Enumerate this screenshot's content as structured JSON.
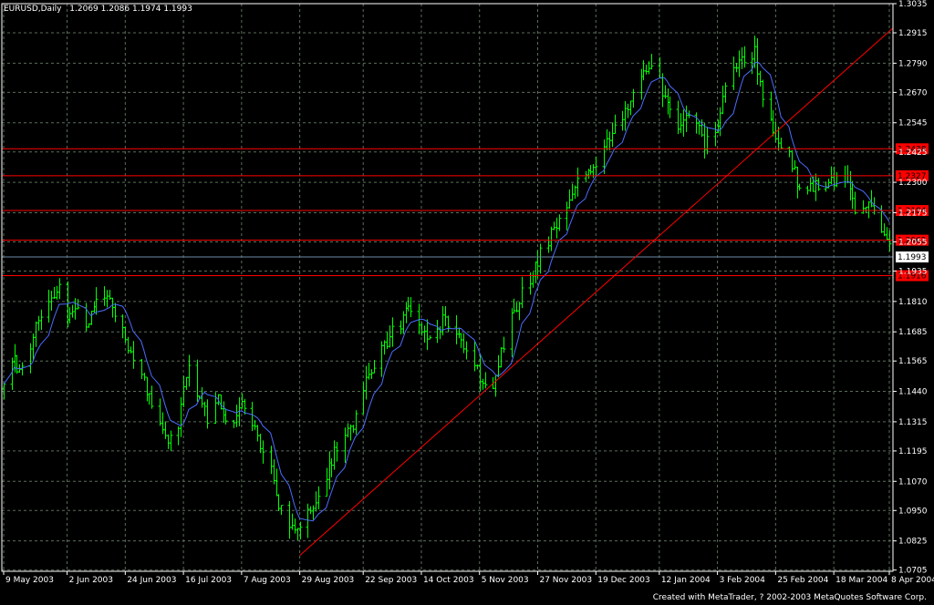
{
  "header": {
    "symbol": "EURUSD,Daily",
    "ohlc": "1.2069 1.2086 1.1974 1.1993"
  },
  "footer": {
    "credit": "Created with MetaTrader, ? 2002-2003 MetaQuotes Software Corp."
  },
  "colors": {
    "background": "#000000",
    "frame": "#ffffff",
    "grid": "#5a6e5a",
    "bars": "#00ff00",
    "moving_average": "#4c6cff",
    "levels": "#ff0000",
    "price_line": "#6e8aa8"
  },
  "chart_data": {
    "type": "ohlc_bar",
    "ylim": [
      1.07,
      1.3035
    ],
    "grid": true,
    "y_ticks": [
      "1.3035",
      "1.2915",
      "1.2790",
      "1.2670",
      "1.2545",
      "1.2425",
      "1.2300",
      "1.2175",
      "1.2055",
      "1.1935",
      "1.1810",
      "1.1685",
      "1.1565",
      "1.1440",
      "1.1315",
      "1.1195",
      "1.1070",
      "1.0950",
      "1.0825",
      "1.0705"
    ],
    "x_ticks": [
      "9 May 2003",
      "2 Jun 2003",
      "24 Jun 2003",
      "16 Jul 2003",
      "7 Aug 2003",
      "29 Aug 2003",
      "22 Sep 2003",
      "14 Oct 2003",
      "5 Nov 2003",
      "27 Nov 2003",
      "19 Dec 2003",
      "12 Jan 2004",
      "3 Feb 2004",
      "25 Feb 2004",
      "18 Mar 2004",
      "8 Apr 2004"
    ],
    "current_price": "1.1993",
    "horizontal_levels": [
      "1.2438",
      "1.2327",
      "1.2184",
      "1.2062",
      "1.1916"
    ],
    "trendline": {
      "from": [
        "29 Aug 2003",
        1.0765
      ],
      "to": [
        "8 Apr 2004",
        1.2845
      ]
    },
    "close_path": [
      [
        "9 May 2003",
        1.145
      ],
      [
        "13 May 2003",
        1.156
      ],
      [
        "16 May 2003",
        1.152
      ],
      [
        "21 May 2003",
        1.17
      ],
      [
        "26 May 2003",
        1.181
      ],
      [
        "30 May 2003",
        1.188
      ],
      [
        "2 Jun 2003",
        1.176
      ],
      [
        "5 Jun 2003",
        1.18
      ],
      [
        "9 Jun 2003",
        1.17
      ],
      [
        "12 Jun 2003",
        1.179
      ],
      [
        "16 Jun 2003",
        1.185
      ],
      [
        "20 Jun 2003",
        1.175
      ],
      [
        "24 Jun 2003",
        1.165
      ],
      [
        "27 Jun 2003",
        1.156
      ],
      [
        "1 Jul 2003",
        1.147
      ],
      [
        "4 Jul 2003",
        1.137
      ],
      [
        "8 Jul 2003",
        1.13
      ],
      [
        "11 Jul 2003",
        1.123
      ],
      [
        "14 Jul 2003",
        1.13
      ],
      [
        "16 Jul 2003",
        1.145
      ],
      [
        "18 Jul 2003",
        1.152
      ],
      [
        "22 Jul 2003",
        1.142
      ],
      [
        "25 Jul 2003",
        1.133
      ],
      [
        "29 Jul 2003",
        1.14
      ],
      [
        "1 Aug 2003",
        1.13
      ],
      [
        "5 Aug 2003",
        1.134
      ],
      [
        "7 Aug 2003",
        1.138
      ],
      [
        "11 Aug 2003",
        1.129
      ],
      [
        "14 Aug 2003",
        1.123
      ],
      [
        "18 Aug 2003",
        1.113
      ],
      [
        "21 Aug 2003",
        1.098
      ],
      [
        "25 Aug 2003",
        1.088
      ],
      [
        "27 Aug 2003",
        1.085
      ],
      [
        "29 Aug 2003",
        1.09
      ],
      [
        "3 Sep 2003",
        1.096
      ],
      [
        "8 Sep 2003",
        1.108
      ],
      [
        "11 Sep 2003",
        1.12
      ],
      [
        "15 Sep 2003",
        1.124
      ],
      [
        "18 Sep 2003",
        1.13
      ],
      [
        "22 Sep 2003",
        1.145
      ],
      [
        "26 Sep 2003",
        1.155
      ],
      [
        "1 Oct 2003",
        1.165
      ],
      [
        "6 Oct 2003",
        1.172
      ],
      [
        "9 Oct 2003",
        1.178
      ],
      [
        "14 Oct 2003",
        1.17
      ],
      [
        "17 Oct 2003",
        1.165
      ],
      [
        "22 Oct 2003",
        1.173
      ],
      [
        "27 Oct 2003",
        1.17
      ],
      [
        "31 Oct 2003",
        1.16
      ],
      [
        "5 Nov 2003",
        1.15
      ],
      [
        "10 Nov 2003",
        1.147
      ],
      [
        "14 Nov 2003",
        1.164
      ],
      [
        "19 Nov 2003",
        1.18
      ],
      [
        "24 Nov 2003",
        1.19
      ],
      [
        "27 Nov 2003",
        1.198
      ],
      [
        "2 Dec 2003",
        1.208
      ],
      [
        "8 Dec 2003",
        1.22
      ],
      [
        "12 Dec 2003",
        1.229
      ],
      [
        "16 Dec 2003",
        1.236
      ],
      [
        "19 Dec 2003",
        1.239
      ],
      [
        "24 Dec 2003",
        1.248
      ],
      [
        "31 Dec 2003",
        1.26
      ],
      [
        "6 Jan 2004",
        1.278
      ],
      [
        "9 Jan 2004",
        1.276
      ],
      [
        "12 Jan 2004",
        1.27
      ],
      [
        "15 Jan 2004",
        1.26
      ],
      [
        "19 Jan 2004",
        1.25
      ],
      [
        "22 Jan 2004",
        1.256
      ],
      [
        "26 Jan 2004",
        1.253
      ],
      [
        "29 Jan 2004",
        1.246
      ],
      [
        "3 Feb 2004",
        1.252
      ],
      [
        "6 Feb 2004",
        1.27
      ],
      [
        "11 Feb 2004",
        1.281
      ],
      [
        "17 Feb 2004",
        1.283
      ],
      [
        "20 Feb 2004",
        1.265
      ],
      [
        "25 Feb 2004",
        1.25
      ],
      [
        "1 Mar 2004",
        1.242
      ],
      [
        "4 Mar 2004",
        1.23
      ],
      [
        "9 Mar 2004",
        1.229
      ],
      [
        "15 Mar 2004",
        1.228
      ],
      [
        "18 Mar 2004",
        1.23
      ],
      [
        "23 Mar 2004",
        1.232
      ],
      [
        "26 Mar 2004",
        1.22
      ],
      [
        "1 Apr 2004",
        1.223
      ],
      [
        "5 Apr 2004",
        1.21
      ],
      [
        "8 Apr 2004",
        1.2069
      ]
    ]
  }
}
